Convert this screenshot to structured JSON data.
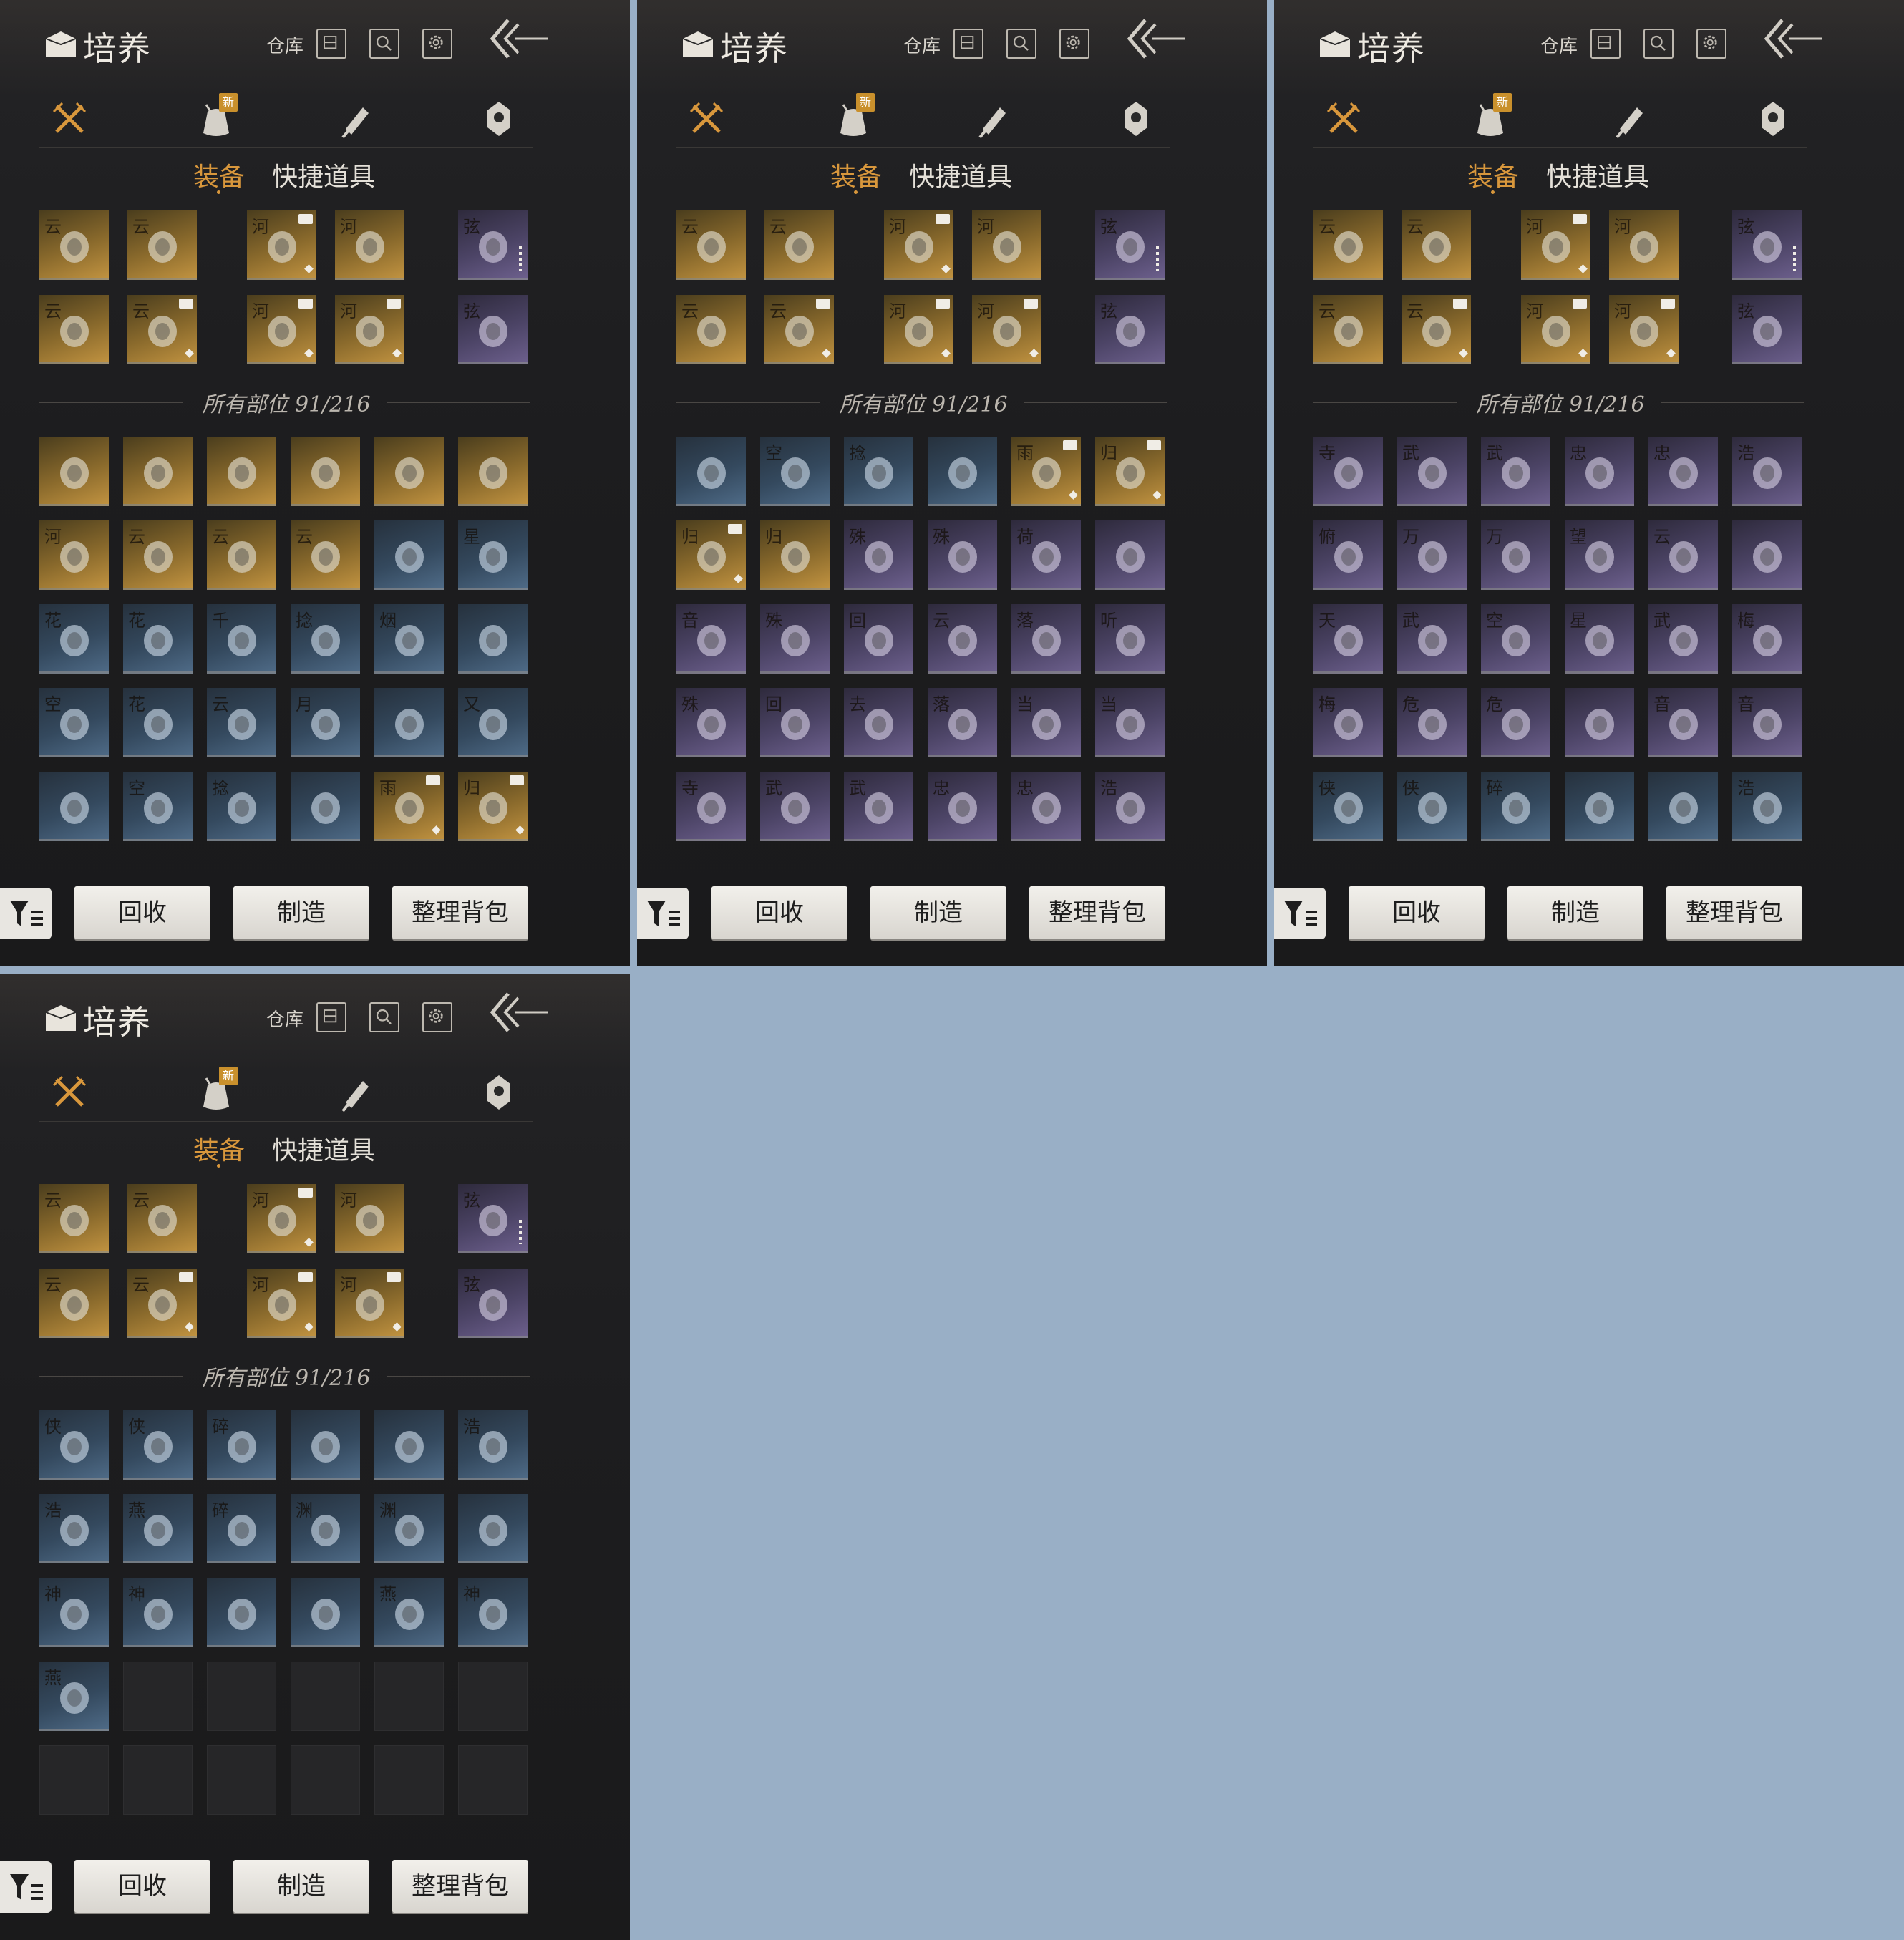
{
  "header": {
    "title": "培养",
    "warehouse_label": "仓库"
  },
  "tabs": [
    {
      "icon": "crossed-swords-icon",
      "active": true
    },
    {
      "icon": "pouch-icon",
      "badge": "新"
    },
    {
      "icon": "scroll-icon"
    },
    {
      "icon": "talisman-icon"
    }
  ],
  "subtabs": {
    "equipment": "装备",
    "quick_items": "快捷道具"
  },
  "count_label": "所有部位 91/216",
  "buttons": {
    "recycle": "回收",
    "craft": "制造",
    "organize": "整理背包"
  },
  "colors": {
    "gold": "#c09240",
    "purple": "#6c5f8c",
    "blue": "#4e6a86",
    "active_tab": "#d8973c"
  },
  "equipped": [
    [
      {
        "r": "gold",
        "g": "云"
      },
      {
        "r": "gold",
        "g": "云"
      },
      {
        "r": "gold",
        "g": "河",
        "tag": true
      },
      {
        "r": "gold",
        "g": "河"
      },
      {
        "r": "purple",
        "g": "弦",
        "dots": true
      }
    ],
    [
      {
        "r": "gold",
        "g": "云"
      },
      {
        "r": "gold",
        "g": "云",
        "tag": true
      },
      {
        "r": "gold",
        "g": "河",
        "tag": true
      },
      {
        "r": "gold",
        "g": "河",
        "tag": true
      },
      {
        "r": "purple",
        "g": "弦"
      }
    ]
  ],
  "panels": [
    {
      "grid": [
        [
          {
            "r": "gold",
            "g": ""
          },
          {
            "r": "gold",
            "g": ""
          },
          {
            "r": "gold",
            "g": ""
          },
          {
            "r": "gold",
            "g": ""
          },
          {
            "r": "gold",
            "g": ""
          },
          {
            "r": "gold",
            "g": ""
          }
        ],
        [
          {
            "r": "gold",
            "g": "河"
          },
          {
            "r": "gold",
            "g": "云"
          },
          {
            "r": "gold",
            "g": "云"
          },
          {
            "r": "gold",
            "g": "云"
          },
          {
            "r": "blue",
            "g": ""
          },
          {
            "r": "blue",
            "g": "星"
          }
        ],
        [
          {
            "r": "blue",
            "g": "花"
          },
          {
            "r": "blue",
            "g": "花"
          },
          {
            "r": "blue",
            "g": "千"
          },
          {
            "r": "blue",
            "g": "捻"
          },
          {
            "r": "blue",
            "g": "烟"
          },
          {
            "r": "blue",
            "g": ""
          }
        ],
        [
          {
            "r": "blue",
            "g": "空"
          },
          {
            "r": "blue",
            "g": "花"
          },
          {
            "r": "blue",
            "g": "云"
          },
          {
            "r": "blue",
            "g": "月"
          },
          {
            "r": "blue",
            "g": ""
          },
          {
            "r": "blue",
            "g": "又"
          }
        ],
        [
          {
            "r": "blue",
            "g": ""
          },
          {
            "r": "blue",
            "g": "空"
          },
          {
            "r": "blue",
            "g": "捻"
          },
          {
            "r": "blue",
            "g": ""
          },
          {
            "r": "gold",
            "g": "雨",
            "tag": true
          },
          {
            "r": "gold",
            "g": "归",
            "tag": true
          }
        ]
      ]
    },
    {
      "grid": [
        [
          {
            "r": "blue",
            "g": ""
          },
          {
            "r": "blue",
            "g": "空"
          },
          {
            "r": "blue",
            "g": "捻"
          },
          {
            "r": "blue",
            "g": ""
          },
          {
            "r": "gold",
            "g": "雨",
            "tag": true
          },
          {
            "r": "gold",
            "g": "归",
            "tag": true
          }
        ],
        [
          {
            "r": "gold",
            "g": "归",
            "tag": true
          },
          {
            "r": "gold",
            "g": "归"
          },
          {
            "r": "purple",
            "g": "殊"
          },
          {
            "r": "purple",
            "g": "殊"
          },
          {
            "r": "purple",
            "g": "荷"
          },
          {
            "r": "purple",
            "g": ""
          }
        ],
        [
          {
            "r": "purple",
            "g": "音"
          },
          {
            "r": "purple",
            "g": "殊"
          },
          {
            "r": "purple",
            "g": "回"
          },
          {
            "r": "purple",
            "g": "云"
          },
          {
            "r": "purple",
            "g": "落"
          },
          {
            "r": "purple",
            "g": "听"
          }
        ],
        [
          {
            "r": "purple",
            "g": "殊"
          },
          {
            "r": "purple",
            "g": "回"
          },
          {
            "r": "purple",
            "g": "去"
          },
          {
            "r": "purple",
            "g": "落"
          },
          {
            "r": "purple",
            "g": "当"
          },
          {
            "r": "purple",
            "g": "当"
          }
        ],
        [
          {
            "r": "purple",
            "g": "寺"
          },
          {
            "r": "purple",
            "g": "武"
          },
          {
            "r": "purple",
            "g": "武"
          },
          {
            "r": "purple",
            "g": "忠"
          },
          {
            "r": "purple",
            "g": "忠"
          },
          {
            "r": "purple",
            "g": "浩"
          }
        ]
      ]
    },
    {
      "grid": [
        [
          {
            "r": "purple",
            "g": "寺"
          },
          {
            "r": "purple",
            "g": "武"
          },
          {
            "r": "purple",
            "g": "武"
          },
          {
            "r": "purple",
            "g": "忠"
          },
          {
            "r": "purple",
            "g": "忠"
          },
          {
            "r": "purple",
            "g": "浩"
          }
        ],
        [
          {
            "r": "purple",
            "g": "俯"
          },
          {
            "r": "purple",
            "g": "万"
          },
          {
            "r": "purple",
            "g": "万"
          },
          {
            "r": "purple",
            "g": "望"
          },
          {
            "r": "purple",
            "g": "云"
          },
          {
            "r": "purple",
            "g": ""
          }
        ],
        [
          {
            "r": "purple",
            "g": "天"
          },
          {
            "r": "purple",
            "g": "武"
          },
          {
            "r": "purple",
            "g": "空"
          },
          {
            "r": "purple",
            "g": "星"
          },
          {
            "r": "purple",
            "g": "武"
          },
          {
            "r": "purple",
            "g": "梅"
          }
        ],
        [
          {
            "r": "purple",
            "g": "梅"
          },
          {
            "r": "purple",
            "g": "危"
          },
          {
            "r": "purple",
            "g": "危"
          },
          {
            "r": "purple",
            "g": ""
          },
          {
            "r": "purple",
            "g": "音"
          },
          {
            "r": "purple",
            "g": "音"
          }
        ],
        [
          {
            "r": "blue",
            "g": "侠"
          },
          {
            "r": "blue",
            "g": "侠"
          },
          {
            "r": "blue",
            "g": "碎"
          },
          {
            "r": "blue",
            "g": ""
          },
          {
            "r": "blue",
            "g": ""
          },
          {
            "r": "blue",
            "g": "浩"
          }
        ]
      ]
    },
    {
      "grid": [
        [
          {
            "r": "blue",
            "g": "侠"
          },
          {
            "r": "blue",
            "g": "侠"
          },
          {
            "r": "blue",
            "g": "碎"
          },
          {
            "r": "blue",
            "g": ""
          },
          {
            "r": "blue",
            "g": ""
          },
          {
            "r": "blue",
            "g": "浩"
          }
        ],
        [
          {
            "r": "blue",
            "g": "浩"
          },
          {
            "r": "blue",
            "g": "燕"
          },
          {
            "r": "blue",
            "g": "碎"
          },
          {
            "r": "blue",
            "g": "渊"
          },
          {
            "r": "blue",
            "g": "渊"
          },
          {
            "r": "blue",
            "g": ""
          }
        ],
        [
          {
            "r": "blue",
            "g": "神"
          },
          {
            "r": "blue",
            "g": "神"
          },
          {
            "r": "blue",
            "g": ""
          },
          {
            "r": "blue",
            "g": ""
          },
          {
            "r": "blue",
            "g": "燕"
          },
          {
            "r": "blue",
            "g": "神"
          }
        ],
        [
          {
            "r": "blue",
            "g": "燕"
          },
          {
            "r": "empty",
            "g": ""
          },
          {
            "r": "empty",
            "g": ""
          },
          {
            "r": "empty",
            "g": ""
          },
          {
            "r": "empty",
            "g": ""
          },
          {
            "r": "empty",
            "g": ""
          }
        ],
        [
          {
            "r": "empty",
            "g": ""
          },
          {
            "r": "empty",
            "g": ""
          },
          {
            "r": "empty",
            "g": ""
          },
          {
            "r": "empty",
            "g": ""
          },
          {
            "r": "empty",
            "g": ""
          },
          {
            "r": "empty",
            "g": ""
          }
        ]
      ]
    }
  ]
}
